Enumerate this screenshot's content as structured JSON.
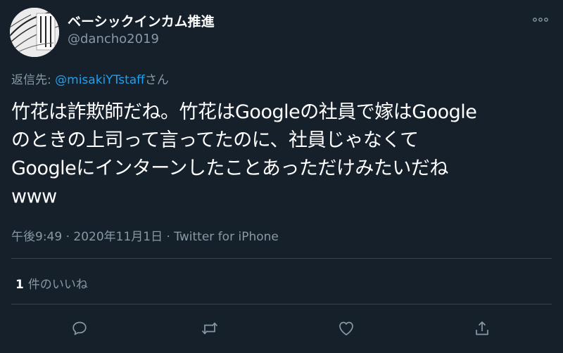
{
  "author": {
    "display_name": "ベーシックインカム推進",
    "handle": "@dancho2019",
    "avatar_icon": "manga-avatar-image"
  },
  "more_icon": "more-horizontal-icon",
  "reply": {
    "prefix": "返信先: ",
    "mention": "@misakiYTstaff",
    "suffix": "さん"
  },
  "tweet": {
    "lines": [
      "竹花は詐欺師だね。竹花はGoogleの社員で嫁はGoogle",
      "のときの上司って言ってたのに、社員じゃなくて",
      "Googleにインターンしたことあっただけみたいだね",
      "www"
    ]
  },
  "meta": {
    "text": "午後9:49 · 2020年11月1日 · Twitter for iPhone"
  },
  "likes": {
    "count": "1",
    "label": "件のいいね"
  },
  "actions": [
    {
      "name": "reply",
      "icon": "reply-icon"
    },
    {
      "name": "retweet",
      "icon": "retweet-icon"
    },
    {
      "name": "like",
      "icon": "like-icon"
    },
    {
      "name": "share",
      "icon": "share-icon"
    }
  ],
  "colors": {
    "background": "#15202b",
    "text": "#ffffff",
    "secondary": "#8899a6",
    "accent": "#1da1f2",
    "divider": "#38444d"
  }
}
